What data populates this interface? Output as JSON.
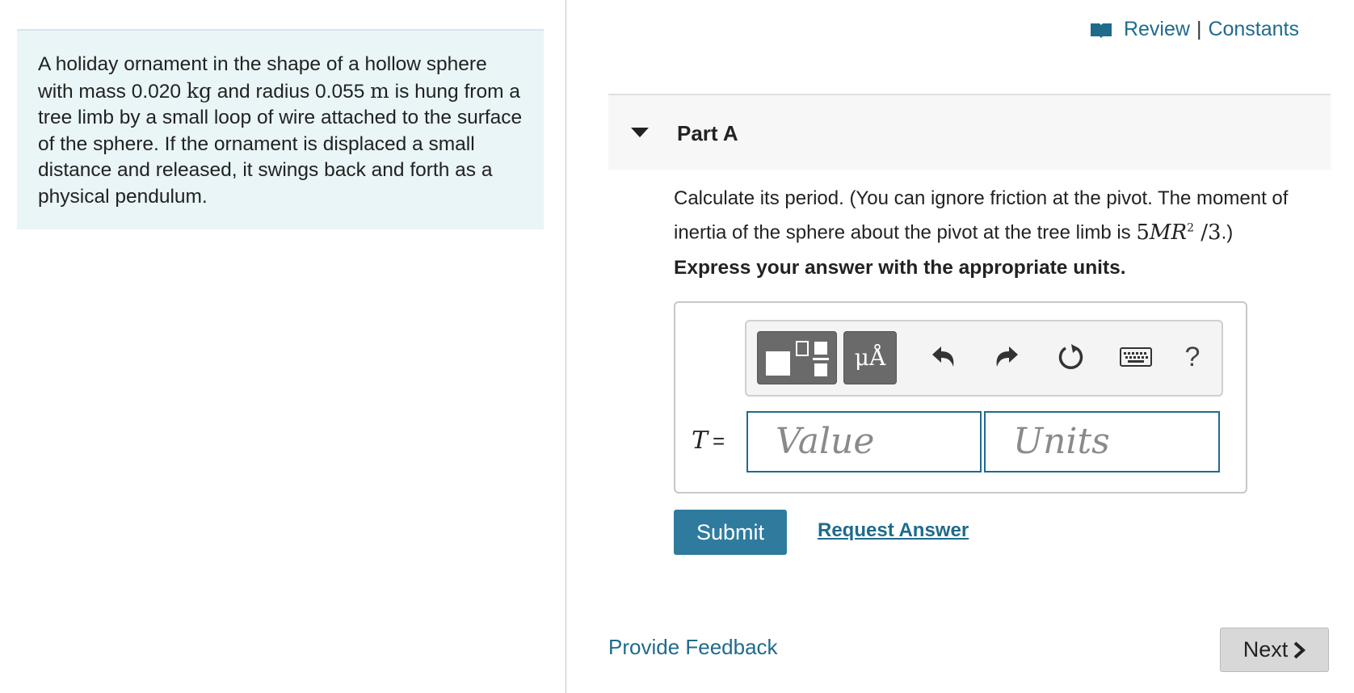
{
  "problem": {
    "text_1": "A holiday ornament in the shape of a hollow sphere with mass 0.020 ",
    "unit_kg": "kg",
    "text_2": " and radius 0.055 ",
    "unit_m": "m",
    "text_3": " is hung from a tree limb by a small loop of wire attached to the surface of the sphere. If the ornament is displaced a small distance and released, it swings back and forth as a physical pendulum."
  },
  "header": {
    "review_label": "Review",
    "separator": "|",
    "constants_label": "Constants"
  },
  "part": {
    "title": "Part A",
    "question_text": "Calculate its period. (You can ignore friction at the pivot. The moment of inertia of the sphere about the pivot at the tree limb is ",
    "question_math_pre": "5",
    "question_math_var": "MR",
    "question_math_exp": "2",
    "question_math_post": " /3",
    "question_end": ".)",
    "instruction": "Express your answer with the appropriate units."
  },
  "answer": {
    "variable": "T",
    "equals": "=",
    "value_placeholder": "Value",
    "units_placeholder": "Units",
    "units_button": "μÅ",
    "help_label": "?"
  },
  "actions": {
    "submit_label": "Submit",
    "request_answer_label": "Request Answer",
    "feedback_label": "Provide Feedback",
    "next_label": "Next"
  },
  "colors": {
    "accent": "#1f6b8c",
    "submit_bg": "#2f7b9e",
    "problem_bg": "#e9f5f7"
  }
}
